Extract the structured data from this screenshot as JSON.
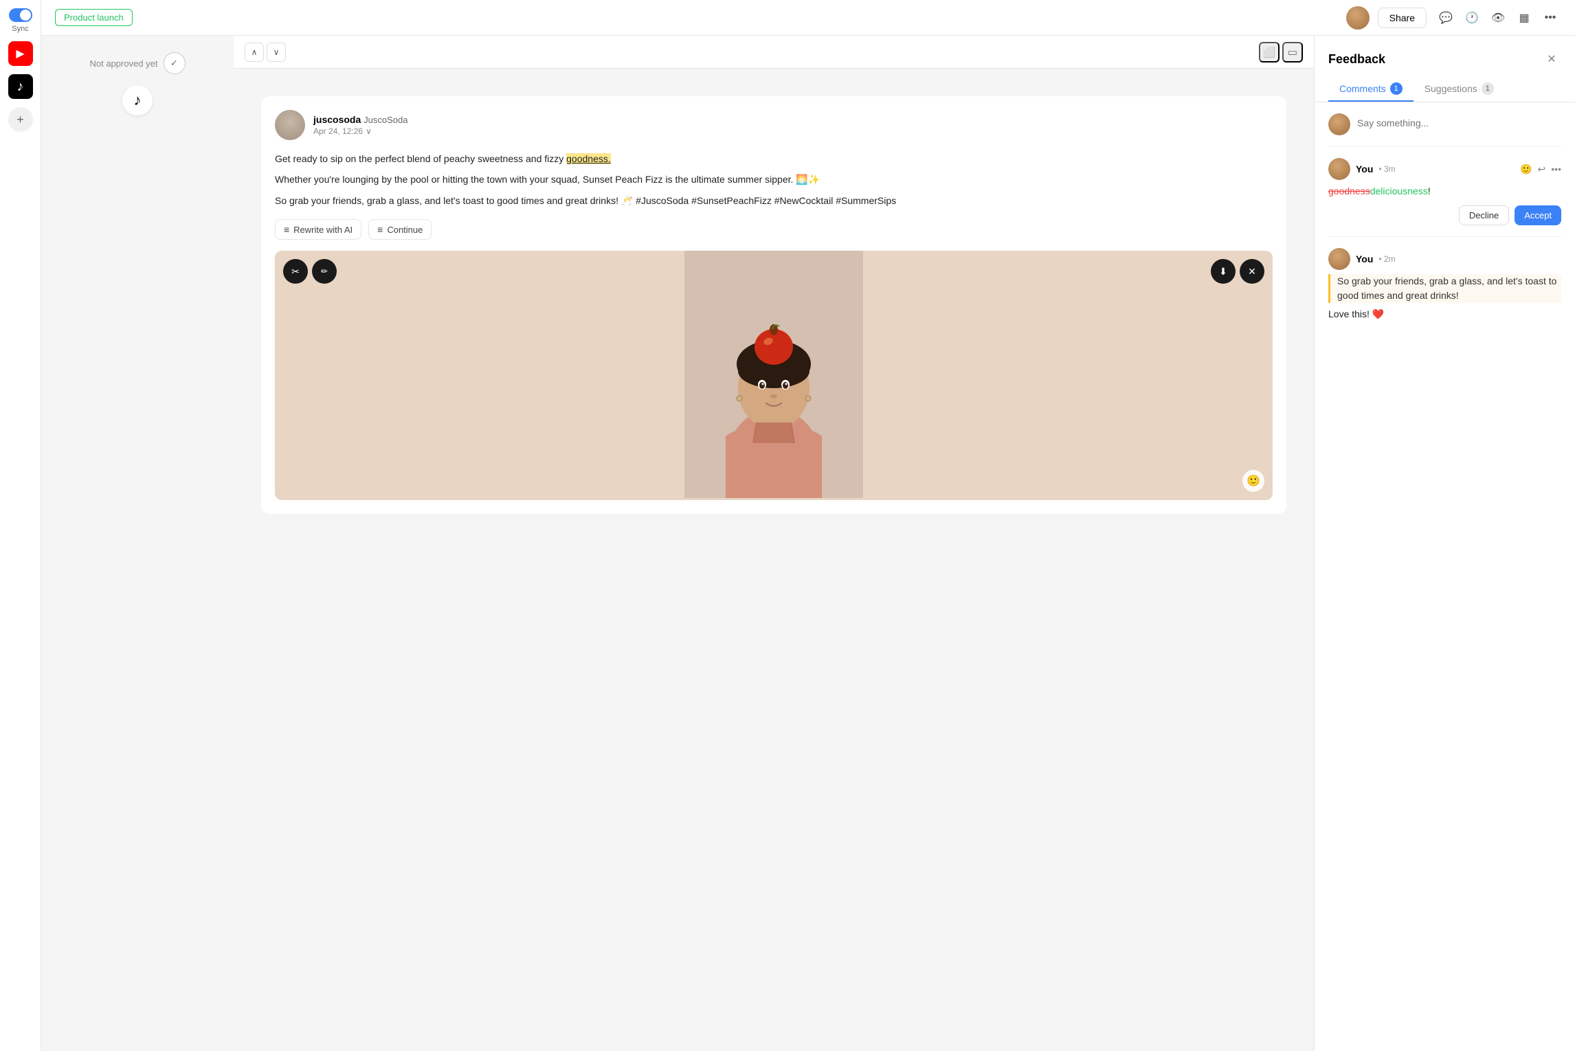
{
  "topbar": {
    "product_label": "Product launch",
    "share_label": "Share",
    "avatar_alt": "User avatar"
  },
  "sidebar": {
    "sync_label": "Sync",
    "toggle_on": true,
    "youtube_icon": "▶",
    "tiktok_icon": "♪",
    "add_icon": "+"
  },
  "left_panel": {
    "not_approved_label": "Not approved yet",
    "check_icon": "✓",
    "platform_icon": "♪"
  },
  "center_toolbar": {
    "up_arrow": "∧",
    "down_arrow": "∨",
    "desktop_icon": "⬜",
    "mobile_icon": "▭"
  },
  "post": {
    "author": "juscosoda",
    "handle": "JuscoSoda",
    "date": "Apr 24, 12:26",
    "content_line1": "Get ready to sip on the perfect blend of peachy sweetness and fizzy goodness.",
    "content_highlighted": "goodness.",
    "content_line2": "Whether you're lounging by the pool or hitting the town with your squad, Sunset Peach Fizz is the ultimate summer sipper. 🌅✨",
    "content_line3": "So grab your friends, grab a glass, and let's toast to good times and great drinks! 🥂 #JuscoSoda #SunsetPeachFizz #NewCocktail #SummerSips",
    "rewrite_btn": "Rewrite with AI",
    "continue_btn": "Continue",
    "emoji_reaction": "🙂",
    "crop_icon": "✂",
    "annotate_icon": "✏",
    "download_icon": "⬇",
    "close_icon": "✕"
  },
  "feedback": {
    "title": "Feedback",
    "comments_tab": "Comments",
    "comments_count": "1",
    "suggestions_tab": "Suggestions",
    "suggestions_count": "1",
    "input_placeholder": "Say something...",
    "comment1": {
      "username": "You",
      "time": "3m",
      "strikethrough_text": "goodness",
      "inserted_text": "deliciousness",
      "punctuation": "!",
      "decline_btn": "Decline",
      "accept_btn": "Accept"
    },
    "comment2": {
      "username": "You",
      "time": "2m",
      "quoted_text": "So grab your friends, grab a glass, and let's toast to good times and great drinks!",
      "text": "Love this! ❤️"
    }
  }
}
